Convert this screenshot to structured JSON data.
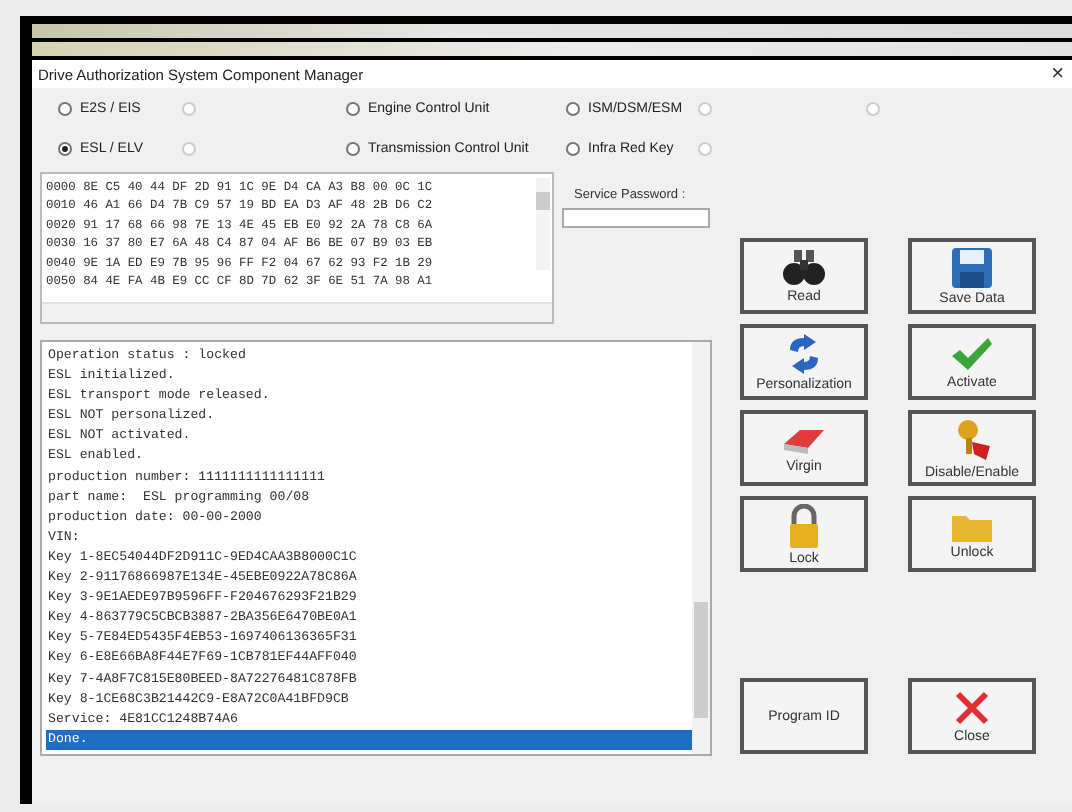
{
  "window": {
    "title": "Drive Authorization System Component Manager",
    "close": "×"
  },
  "radio_rows": [
    [
      {
        "label": "E2S / EIS",
        "selected": false,
        "disabled": false
      },
      {
        "selected": false,
        "disabled": true
      },
      {
        "label": "Engine Control Unit",
        "selected": false,
        "disabled": false
      },
      {
        "label": "ISM/DSM/ESM",
        "selected": false,
        "disabled": false
      },
      {
        "selected": false,
        "disabled": true
      },
      {
        "selected": false,
        "disabled": true
      }
    ],
    [
      {
        "label": "ESL / ELV",
        "selected": true,
        "disabled": false
      },
      {
        "selected": false,
        "disabled": true
      },
      {
        "label": "Transmission Control Unit",
        "selected": false,
        "disabled": false
      },
      {
        "label": "Infra Red Key",
        "selected": false,
        "disabled": false
      },
      {
        "selected": false,
        "disabled": true
      }
    ]
  ],
  "hex_view": {
    "rows": [
      {
        "address": "0000",
        "bytes": "8E C5 40 44 DF 2D 91 1C 9E D4 CA A3 B8 00 0C 1C"
      },
      {
        "address": "0010",
        "bytes": "46 A1 66 D4 7B C9 57 19 BD EA D3 AF 48 2B D6 C2"
      },
      {
        "address": "0020",
        "bytes": "91 17 68 66 98 7E 13 4E 45 EB E0 92 2A 78 C8 6A"
      },
      {
        "address": "0030",
        "bytes": "16 37 80 E7 6A 48 C4 87 04 AF B6 BE 07 B9 03 EB"
      },
      {
        "address": "0040",
        "bytes": "9E 1A ED E9 7B 95 96 FF F2 04 67 62 93 F2 1B 29"
      },
      {
        "address": "0050",
        "bytes": "84 4E FA 4B E9 CC CF 8D 7D 62 3F 6E 51 7A 98 A1"
      }
    ]
  },
  "service_password": {
    "label": "Service Password :"
  },
  "log": [
    {
      "text": "Operation status : locked",
      "selected": false
    },
    {
      "text": "ESL initialized.",
      "selected": false
    },
    {
      "text": "ESL transport mode released.",
      "selected": false
    },
    {
      "text": "ESL NOT personalized.",
      "selected": false
    },
    {
      "text": "ESL NOT activated.",
      "selected": false
    },
    {
      "text": "ESL enabled.",
      "selected": false
    },
    {
      "text": "production number: 1111111111111111",
      "selected": false
    },
    {
      "text": "part name:  ESL programming 00/08",
      "selected": false
    },
    {
      "text": "production date: 00-00-2000",
      "selected": false
    },
    {
      "text": "VIN:",
      "selected": false
    },
    {
      "text": "Key 1-8EC54044DF2D911C-9ED4CAA3B8000C1C",
      "selected": false
    },
    {
      "text": "Key 2-91176866987E134E-45EBE0922A78C86A",
      "selected": false
    },
    {
      "text": "Key 3-9E1AEDE97B9596FF-F204676293F21B29",
      "selected": false
    },
    {
      "text": "Key 4-863779C5CBCB3887-2BA356E6470BE0A1",
      "selected": false
    },
    {
      "text": "Key 5-7E84ED5435F4EB53-1697406136365F31",
      "selected": false
    },
    {
      "text": "Key 6-E8E66BA8F44E7F69-1CB781EF44AFF040",
      "selected": false
    },
    {
      "text": "Key 7-4A8F7C815E80BEED-8A72276481C878FB",
      "selected": false
    },
    {
      "text": "Key 8-1CE68C3B21442C9-E8A72C0A41BFD9CB",
      "selected": false
    },
    {
      "text": "Service: 4E81CC1248B74A6",
      "selected": false
    },
    {
      "text": "Done.",
      "selected": true
    }
  ],
  "buttons": [
    {
      "label": "Read"
    },
    {
      "label": "Save Data"
    },
    {
      "label": "Personalization"
    },
    {
      "label": "Activate"
    },
    {
      "label": "Virgin"
    },
    {
      "label": "Disable/Enable"
    },
    {
      "label": "Lock"
    },
    {
      "label": "Unlock"
    }
  ],
  "bottom_buttons": [
    {
      "label": "Program ID"
    },
    {
      "label": "Close"
    }
  ]
}
